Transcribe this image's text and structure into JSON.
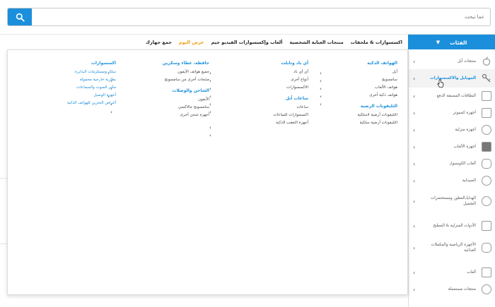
{
  "search": {
    "placeholder": "عما تبحث"
  },
  "topnav": {
    "categories_label": "الفئات",
    "links": [
      "جمع جهازك",
      "عرض اليوم",
      "ألعاب وإكسسوارات الفيديو جيم",
      "منتجات العناية الشخصية",
      "اكسسوارات & ملحقات"
    ]
  },
  "sidebar": {
    "items": [
      "منتجات آبل",
      "الموبايل والاكسسوارات",
      "البطاقات المسبقة الدفع",
      "أجهزة كمبيوتر",
      "أجهزة منزلية",
      "أجهزة الألعاب",
      "ألعاب الكونسول",
      "الصيدلية",
      "الهدايا,العطور ومستحضرات التجميل",
      "الأدوات المنزلية & المطبخ",
      "الأجهزة الرياضية والمكملات الغذائية",
      "ألعاب",
      "منتجات مستعملة"
    ]
  },
  "mega": {
    "col1": {
      "head": "الهواتف الذكية",
      "items": [
        "آبل",
        "سامسونج",
        "هواتف الألعاب",
        "هواتف ذكية أخرى"
      ],
      "head2": "التليفونات الرضية",
      "items2": [
        "التليفونات أرضية لاسلكية",
        "التليفونات أرضية سلكية"
      ]
    },
    "col2": {
      "head": "آي باد وتابلت",
      "items": [
        "آي أي باد",
        "أنواع أخرى",
        "الاكسسوارات"
      ],
      "head2": "ساعات آبل",
      "items2": [
        "ساعات",
        "اكسسوارات للساعات",
        "أجهزة التعقب الذكية"
      ]
    },
    "col3": {
      "head": "حافظة، غطاء وسكرين",
      "items": [
        "جميع هواتف الآيفون",
        "منتجات أخرى من سامسونج"
      ],
      "head2": "الشاحن والوصلات",
      "items2": [
        "الآيفون",
        "سامسونج جالاكسي",
        "أجهزة شحن أخرى"
      ]
    },
    "col4": {
      "head": "اكسسوارات",
      "items": [
        "سلك ومستلزمات البدايرة",
        "بطارية خارجية محمولة",
        "مكبر الصوت والسماعات",
        "أجهزة الوصيل",
        "أغراض التخزين للهواتف الذكية"
      ]
    }
  }
}
